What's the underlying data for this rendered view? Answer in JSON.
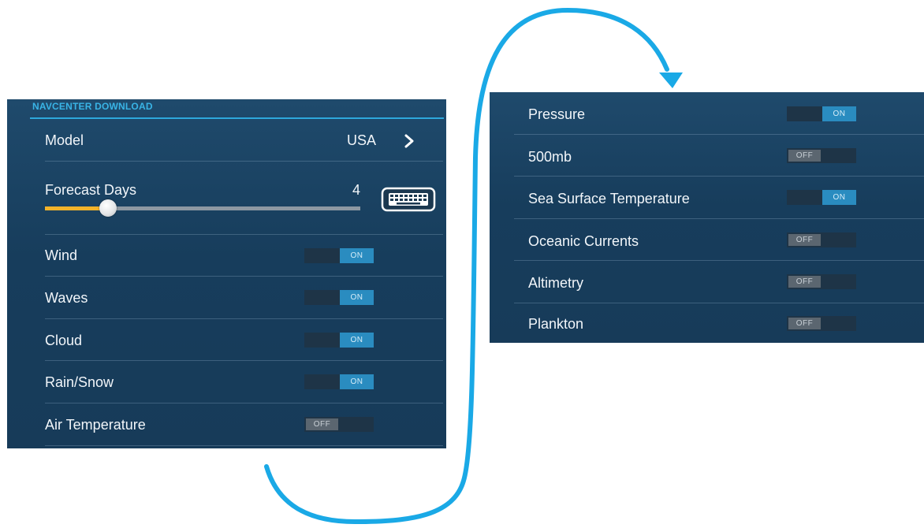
{
  "colors": {
    "accent": "#1aa9e6",
    "panel_bg": "#1c4566",
    "toggle_on": "#2a8cc0",
    "toggle_off": "#5b6670",
    "slider_fill": "#f3b32a"
  },
  "left_panel": {
    "title": "NAVCENTER DOWNLOAD",
    "model": {
      "label": "Model",
      "value": "USA",
      "icon": "chevron-right-icon"
    },
    "forecast_days": {
      "label": "Forecast Days",
      "value": "4",
      "level": 0.2,
      "icon": "keyboard-icon"
    },
    "items": [
      {
        "label": "Wind",
        "state": "ON"
      },
      {
        "label": "Waves",
        "state": "ON"
      },
      {
        "label": "Cloud",
        "state": "ON"
      },
      {
        "label": "Rain/Snow",
        "state": "ON"
      },
      {
        "label": "Air Temperature",
        "state": "OFF"
      }
    ]
  },
  "right_panel": {
    "items": [
      {
        "label": "Pressure",
        "state": "ON"
      },
      {
        "label": "500mb",
        "state": "OFF"
      },
      {
        "label": "Sea Surface Temperature",
        "state": "ON"
      },
      {
        "label": "Oceanic Currents",
        "state": "OFF"
      },
      {
        "label": "Altimetry",
        "state": "OFF"
      },
      {
        "label": "Plankton",
        "state": "OFF"
      }
    ]
  },
  "connector": {
    "icon": "continuation-arrow-icon"
  }
}
